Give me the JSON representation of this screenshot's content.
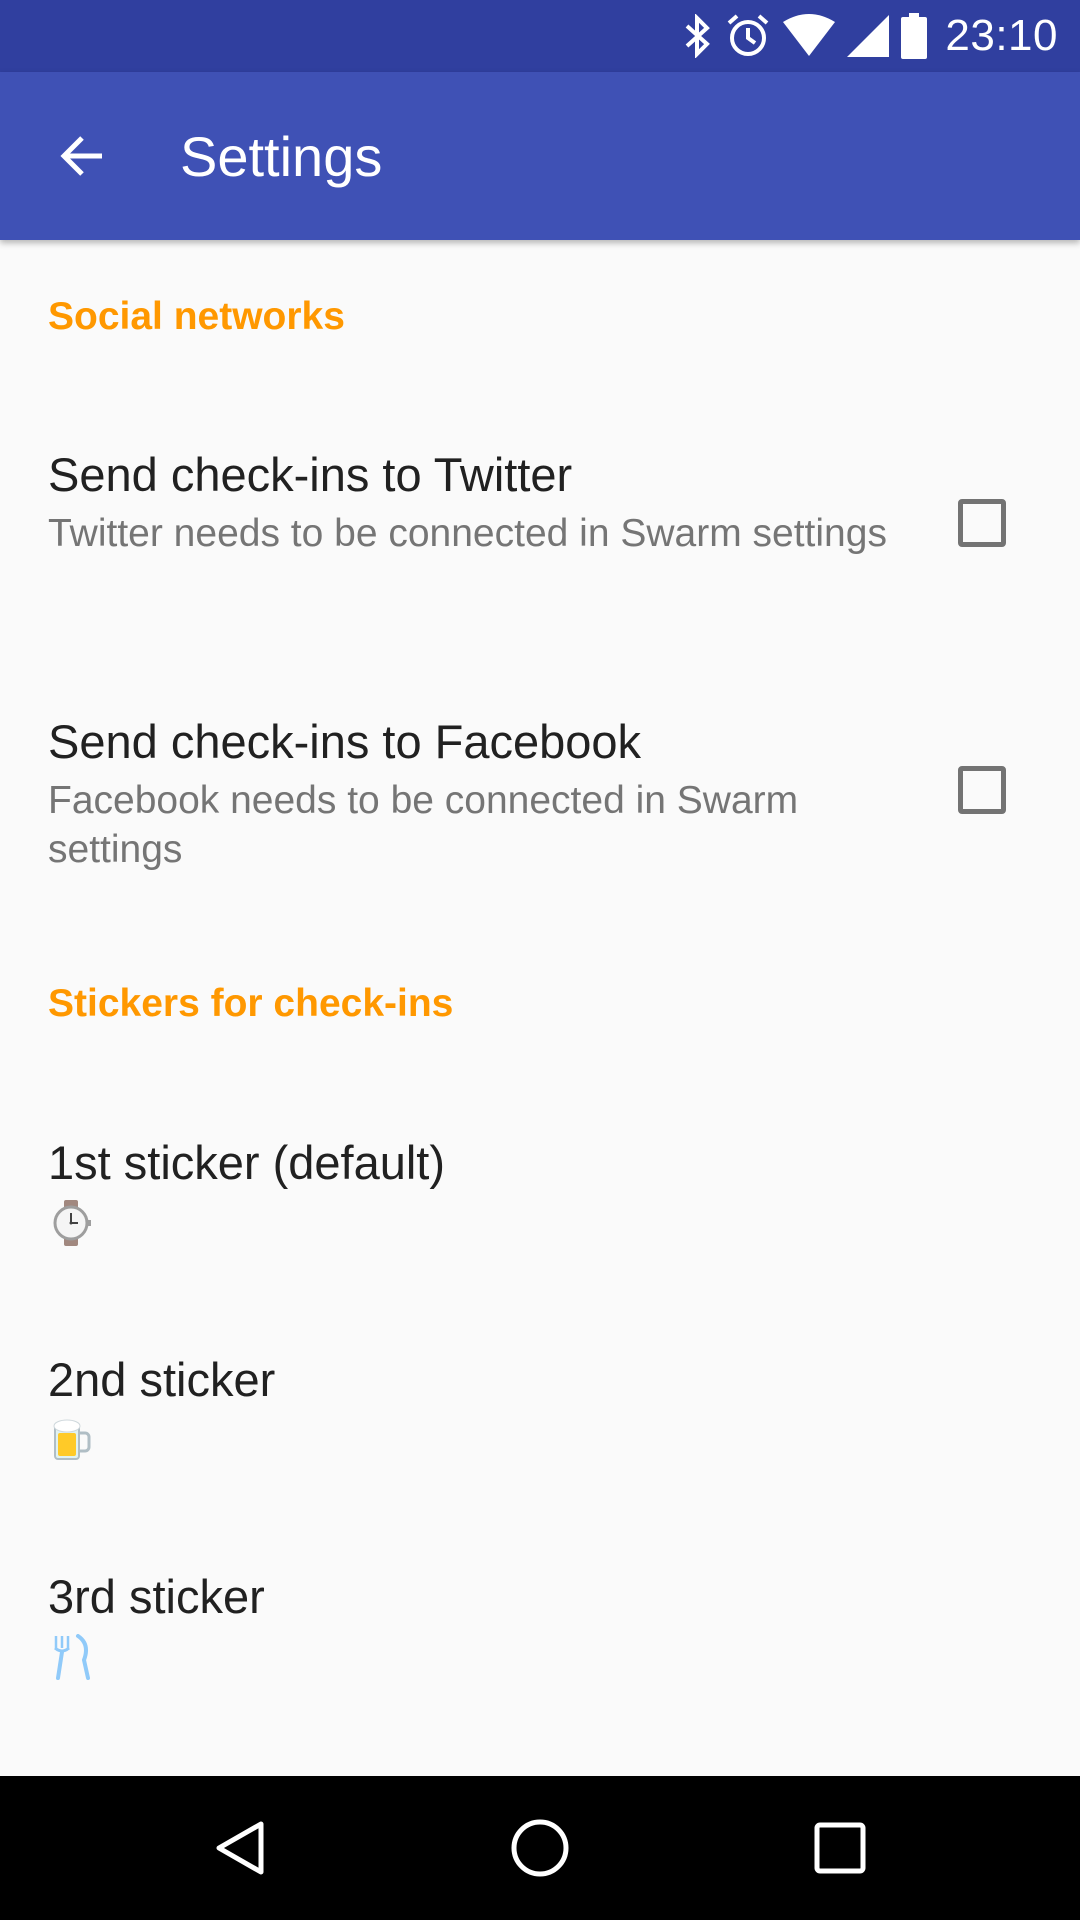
{
  "status_bar": {
    "time": "23:10",
    "icons": [
      "bluetooth-icon",
      "alarm-icon",
      "wifi-icon",
      "cell-signal-icon",
      "battery-icon"
    ]
  },
  "app_bar": {
    "title": "Settings",
    "back_icon": "arrow-back-icon"
  },
  "sections": [
    {
      "header": "Social networks",
      "items": [
        {
          "title": "Send check-ins to Twitter",
          "summary": "Twitter needs to be connected in Swarm settings",
          "checked": false
        },
        {
          "title": "Send check-ins to Facebook",
          "summary": "Facebook needs to be connected in Swarm settings",
          "checked": false
        }
      ]
    },
    {
      "header": "Stickers for check-ins",
      "items": [
        {
          "title": "1st sticker (default)",
          "sticker": "watch-sticker-icon"
        },
        {
          "title": "2nd sticker",
          "sticker": "beer-mug-sticker-icon"
        },
        {
          "title": "3rd sticker",
          "sticker": "fork-knife-sticker-icon"
        }
      ]
    }
  ],
  "nav_bar": {
    "icons": [
      "back-triangle-icon",
      "home-circle-icon",
      "recents-square-icon"
    ]
  },
  "colors": {
    "status_bar": "#303f9f",
    "app_bar": "#3f51b5",
    "accent": "#ff9800",
    "background": "#fafafa",
    "primary_text": "#212121",
    "secondary_text": "#757575"
  }
}
